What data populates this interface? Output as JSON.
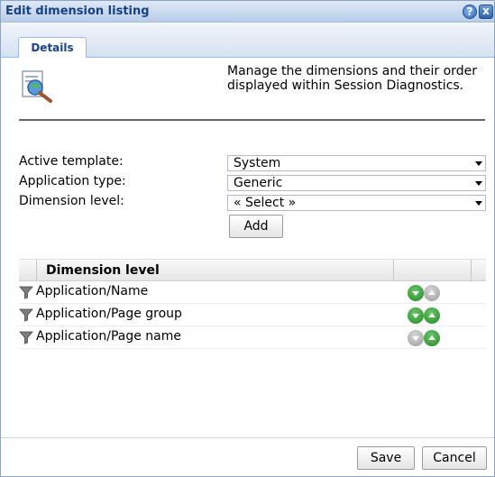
{
  "window": {
    "title": "Edit dimension listing"
  },
  "titlebar": {
    "help_icon": "?",
    "close_icon": "x"
  },
  "tabs": [
    {
      "label": "Details"
    }
  ],
  "header": {
    "description": "Manage the dimensions and their order displayed within Session Diagnostics."
  },
  "form": {
    "active_template": {
      "label": "Active template:",
      "value": "System"
    },
    "application_type": {
      "label": "Application type:",
      "value": "Generic"
    },
    "dimension_level": {
      "label": "Dimension level:",
      "value": "« Select »"
    },
    "add_label": "Add"
  },
  "grid": {
    "header": "Dimension level",
    "rows": [
      {
        "label": "Application/Name",
        "move_down_enabled": true,
        "move_up_enabled": false
      },
      {
        "label": "Application/Page group",
        "move_down_enabled": true,
        "move_up_enabled": true
      },
      {
        "label": "Application/Page name",
        "move_down_enabled": false,
        "move_up_enabled": true
      }
    ]
  },
  "footer": {
    "save_label": "Save",
    "cancel_label": "Cancel"
  },
  "colors": {
    "title_text": "#15428b",
    "move_enabled": "#2a9a2a",
    "move_disabled": "#a8a8a8"
  }
}
